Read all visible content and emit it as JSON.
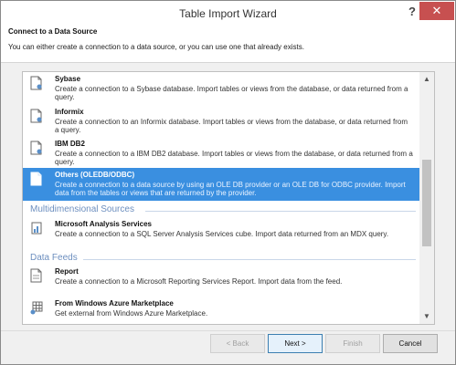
{
  "window": {
    "title": "Table Import Wizard",
    "help_label": "?",
    "close_label": "✕"
  },
  "header": {
    "title": "Connect to a Data Source",
    "description": "You can either create a connection to a data source, or you can use one that already exists."
  },
  "list": {
    "items": [
      {
        "name": "Sybase",
        "description": "Create a connection to a Sybase database. Import tables or views from the database, or data returned from a query.",
        "icon": "database-connection-icon"
      },
      {
        "name": "Informix",
        "description": "Create a connection to an Informix database. Import tables or views from the database, or data returned from a query.",
        "icon": "database-connection-icon"
      },
      {
        "name": "IBM DB2",
        "description": "Create a connection to a IBM DB2 database. Import tables or views from the database, or data returned from a query.",
        "icon": "database-connection-icon"
      },
      {
        "name": "Others (OLEDB/ODBC)",
        "description": "Create a connection to a data source by using an OLE DB provider or an OLE DB for ODBC provider. Import data from the tables or views that are returned by the provider.",
        "icon": "database-connection-icon"
      },
      {
        "name": "Microsoft Analysis Services",
        "description": "Create a connection to a SQL Server Analysis Services cube. Import data returned from an MDX query.",
        "icon": "analysis-services-icon"
      },
      {
        "name": "Report",
        "description": "Create a connection to a Microsoft Reporting Services Report. Import data from the feed.",
        "icon": "report-icon"
      },
      {
        "name": "From Windows Azure Marketplace",
        "description": "Get external from Windows Azure Marketplace.",
        "icon": "marketplace-grid-icon"
      }
    ],
    "groups": {
      "multidimensional": "Multidimensional Sources",
      "data_feeds": "Data Feeds"
    },
    "selected_index": 3
  },
  "scrollbar": {
    "up_glyph": "▲",
    "down_glyph": "▼"
  },
  "footer": {
    "back_label": "< Back",
    "next_label": "Next >",
    "finish_label": "Finish",
    "cancel_label": "Cancel"
  },
  "colors": {
    "selection": "#3a8fe0",
    "group_header": "#6d8fbf",
    "close_button": "#c75050"
  }
}
